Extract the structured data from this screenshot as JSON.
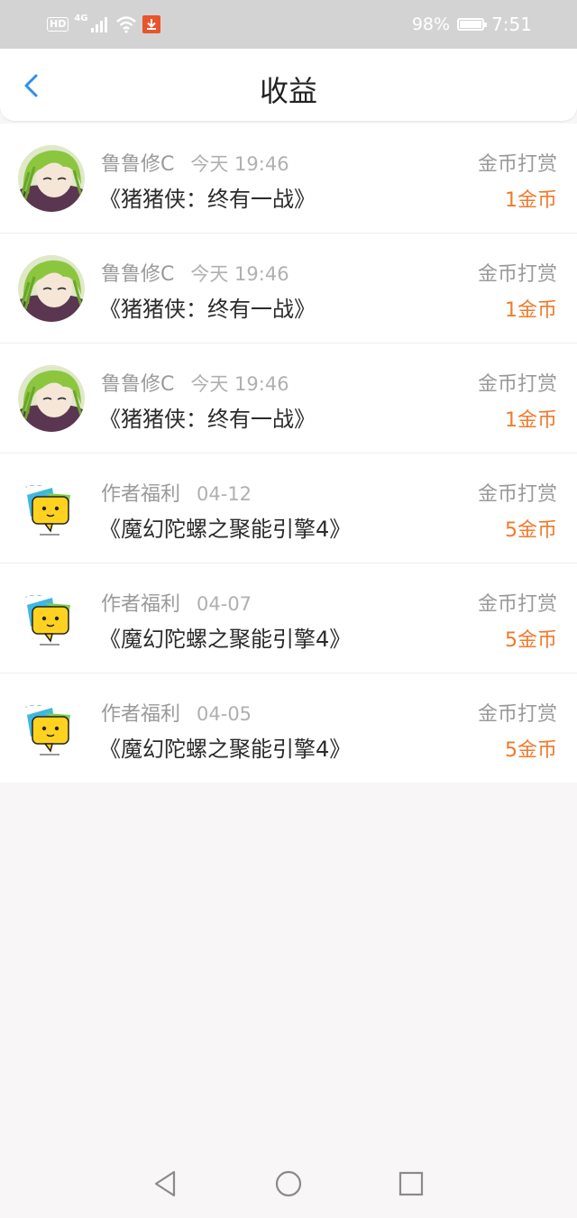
{
  "status": {
    "battery": "98%",
    "time": "7:51",
    "network_hd": "HD",
    "network_gen": "4G",
    "battery_level": 0.98
  },
  "header": {
    "title": "收益"
  },
  "items": [
    {
      "avatar": "anime-avatar",
      "name": "鲁鲁修C",
      "time": "今天 19:46",
      "book": "《猪猪侠：终有一战》",
      "type": "金币打赏",
      "amount": "1金币"
    },
    {
      "avatar": "anime-avatar",
      "name": "鲁鲁修C",
      "time": "今天 19:46",
      "book": "《猪猪侠：终有一战》",
      "type": "金币打赏",
      "amount": "1金币"
    },
    {
      "avatar": "anime-avatar",
      "name": "鲁鲁修C",
      "time": "今天 19:46",
      "book": "《猪猪侠：终有一战》",
      "type": "金币打赏",
      "amount": "1金币"
    },
    {
      "avatar": "speech-bubble-avatar",
      "name": "作者福利",
      "time": "04-12",
      "book": "《魔幻陀螺之聚能引擎4》",
      "type": "金币打赏",
      "amount": "5金币"
    },
    {
      "avatar": "speech-bubble-avatar",
      "name": "作者福利",
      "time": "04-07",
      "book": "《魔幻陀螺之聚能引擎4》",
      "type": "金币打赏",
      "amount": "5金币"
    },
    {
      "avatar": "speech-bubble-avatar",
      "name": "作者福利",
      "time": "04-05",
      "book": "《魔幻陀螺之聚能引擎4》",
      "type": "金币打赏",
      "amount": "5金币"
    }
  ],
  "colors": {
    "accent": "#2d8ff0",
    "amount": "#f07a2c",
    "statusbar": "#d3d3d3"
  }
}
